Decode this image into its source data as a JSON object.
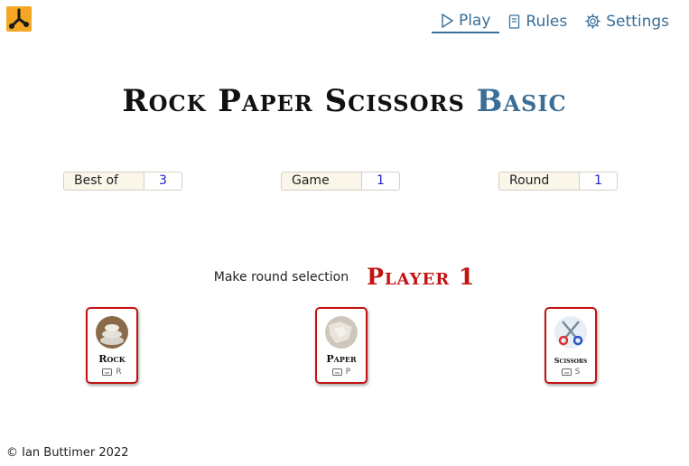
{
  "nav": {
    "play_label": "Play",
    "rules_label": "Rules",
    "settings_label": "Settings"
  },
  "title": {
    "main": "Rock Paper Scissors",
    "accent": "Basic"
  },
  "stats": [
    {
      "label": "Best of",
      "value": "3"
    },
    {
      "label": "Game",
      "value": "1"
    },
    {
      "label": "Round",
      "value": "1"
    }
  ],
  "prompt": {
    "text": "Make round selection",
    "player": "Player 1"
  },
  "choices": [
    {
      "name": "Rock",
      "key": "R",
      "icon": "rock-icon"
    },
    {
      "name": "Paper",
      "key": "P",
      "icon": "paper-icon"
    },
    {
      "name": "Scissors",
      "key": "S",
      "icon": "scissors-icon"
    }
  ],
  "footer": "© Ian Buttimer 2022",
  "colors": {
    "accent": "#3a6e97",
    "player": "#c41212",
    "logo_bg": "#f5a623",
    "card_border": "#c41212",
    "stat_value": "#2323c9"
  }
}
